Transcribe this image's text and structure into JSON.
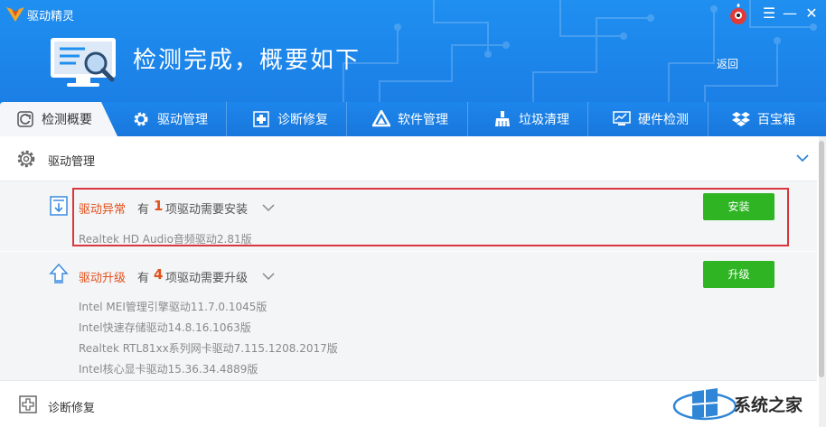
{
  "app": {
    "title": "驱动精灵"
  },
  "header": {
    "headline": "检测完成，概要如下",
    "back": "返回"
  },
  "tabs": [
    {
      "label": "检测概要",
      "icon": "refresh-icon",
      "active": true
    },
    {
      "label": "驱动管理",
      "icon": "gear-icon"
    },
    {
      "label": "诊断修复",
      "icon": "medical-plus-icon"
    },
    {
      "label": "软件管理",
      "icon": "triangle-app-icon"
    },
    {
      "label": "垃圾清理",
      "icon": "broom-icon"
    },
    {
      "label": "硬件检测",
      "icon": "monitor-chart-icon"
    },
    {
      "label": "百宝箱",
      "icon": "dropbox-icon"
    }
  ],
  "section": {
    "title": "驱动管理"
  },
  "anomaly": {
    "title": "驱动异常",
    "prefix": "有",
    "count": "1",
    "suffix": "项驱动需要安装",
    "button": "安装",
    "items": [
      "Realtek HD Audio音频驱动2.81版"
    ]
  },
  "upgrade": {
    "title": "驱动升级",
    "prefix": "有",
    "count": "4",
    "suffix": "项驱动需要升级",
    "button": "升级",
    "items": [
      "Intel MEI管理引擎驱动11.7.0.1045版",
      "Intel快速存储驱动14.8.16.1063版",
      "Realtek RTL81xx系列网卡驱动7.115.1208.2017版",
      "Intel核心显卡驱动15.36.34.4889版"
    ]
  },
  "footer_section": {
    "title": "诊断修复"
  },
  "watermark": {
    "text": "系统之家"
  },
  "colors": {
    "header_blue": "#1f8ff0",
    "accent_red": "#e2501c",
    "button_green": "#2fb424",
    "highlight_red": "#d9363e"
  }
}
